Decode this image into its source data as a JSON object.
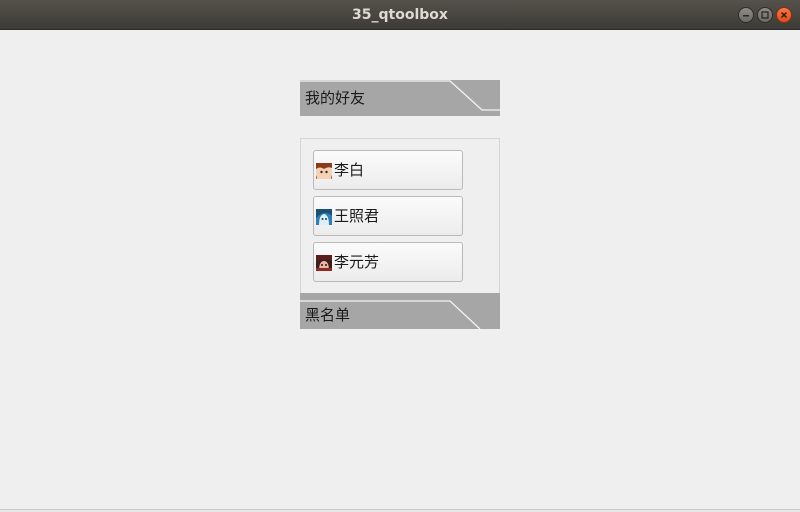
{
  "window": {
    "title": "35_qtoolbox",
    "controls": {
      "minimize": "minimize-icon",
      "maximize": "maximize-icon",
      "close": "close-icon"
    }
  },
  "toolbox": {
    "pages": [
      {
        "title": "我的好友",
        "expanded": true,
        "friends": [
          {
            "name": "李白",
            "avatar": "avatar-libai-icon"
          },
          {
            "name": "王照君",
            "avatar": "avatar-wangzhaojun-icon"
          },
          {
            "name": "李元芳",
            "avatar": "avatar-liyuanfang-icon"
          }
        ]
      },
      {
        "title": "黑名单",
        "expanded": false,
        "friends": []
      }
    ],
    "colors": {
      "header_fill": "#a6a6a6",
      "header_line": "#f2f2f2",
      "panel_border": "#d6d6d6",
      "button_border": "#b9b9b9"
    }
  }
}
